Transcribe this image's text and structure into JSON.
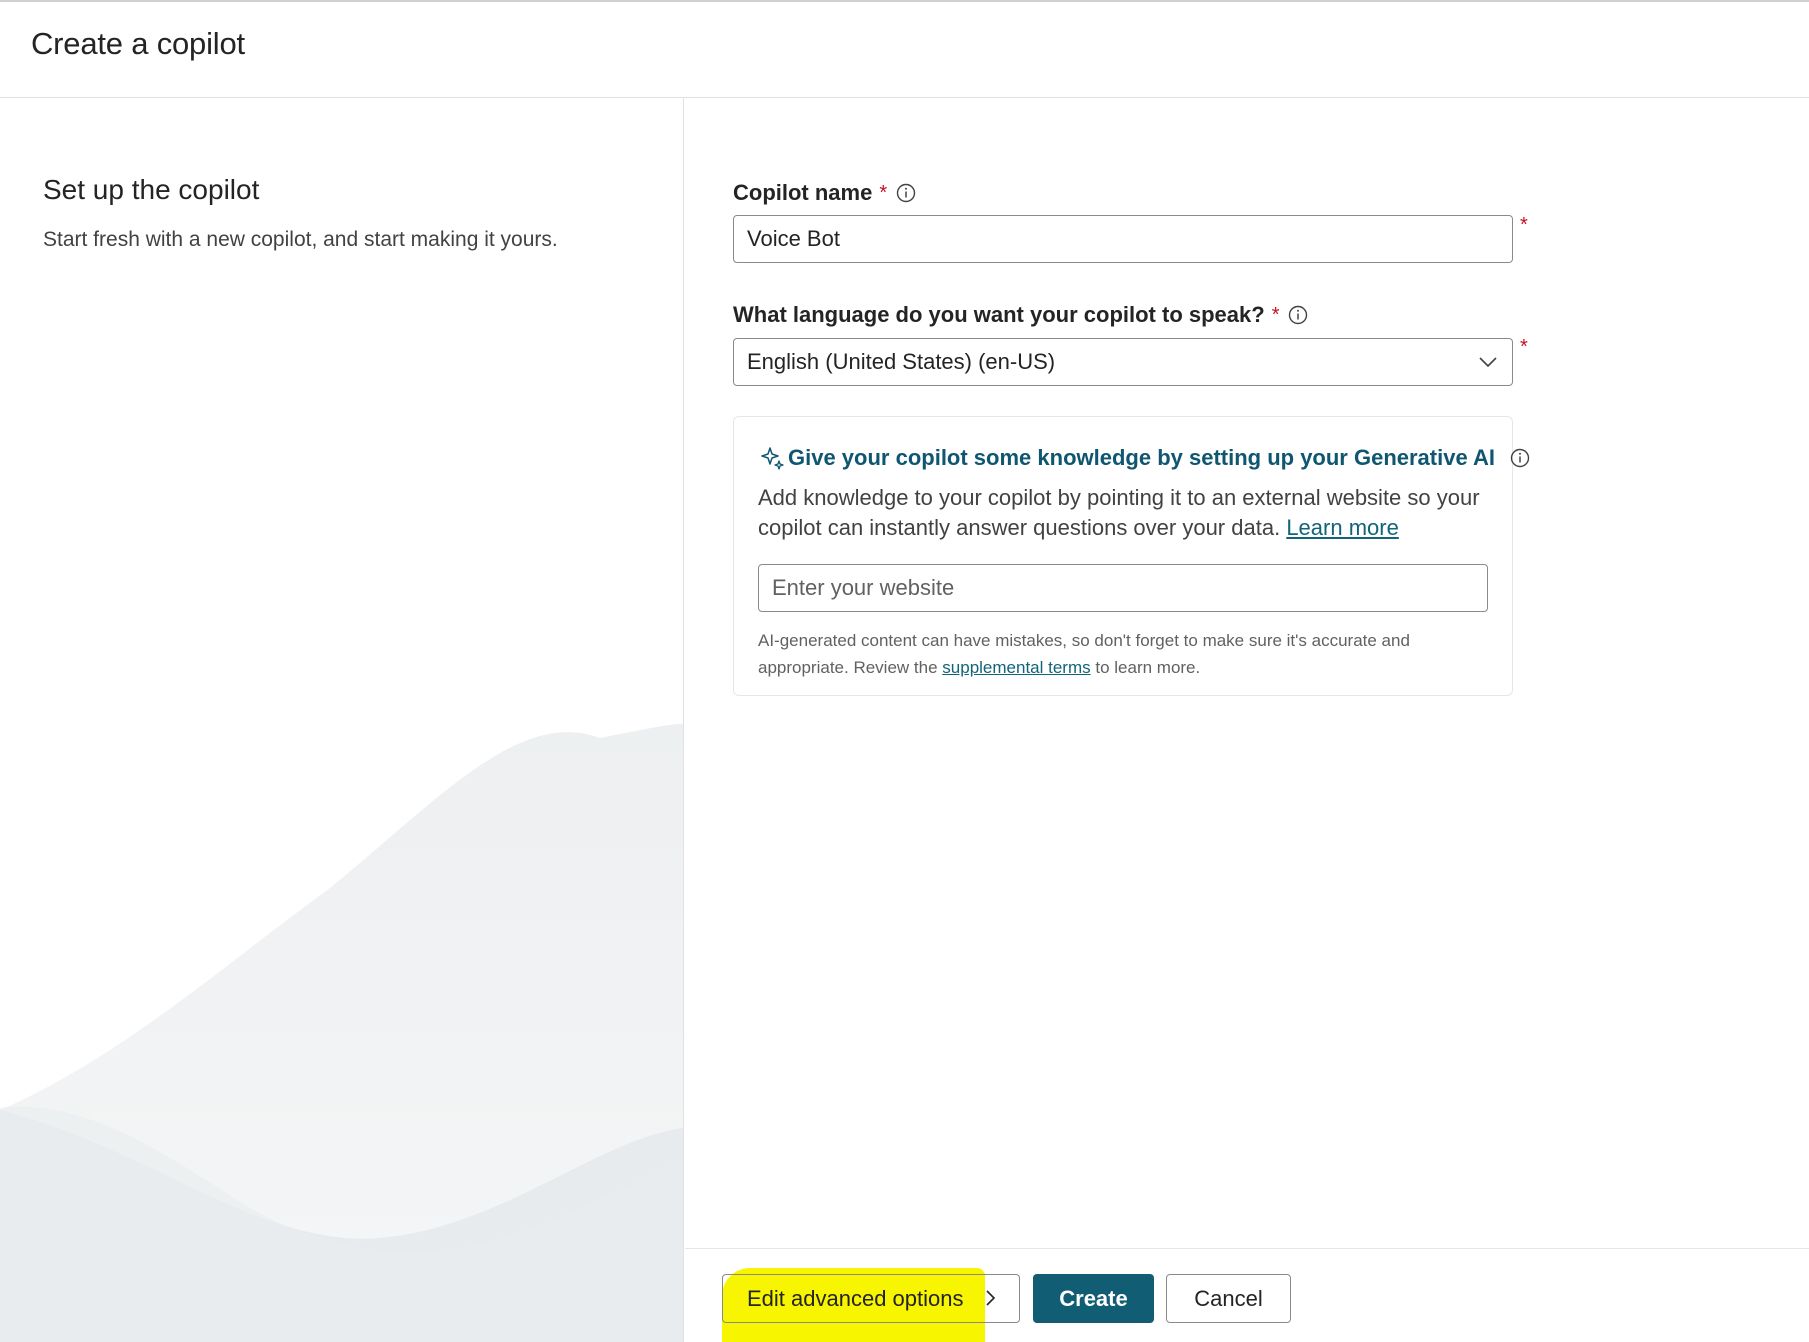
{
  "header": {
    "title": "Create a copilot"
  },
  "intro": {
    "title": "Set up the copilot",
    "subtitle": "Start fresh with a new copilot, and start making it yours."
  },
  "form": {
    "name_label": "Copilot name",
    "name_value": "Voice Bot",
    "language_label": "What language do you want your copilot to speak?",
    "language_value": "English (United States) (en-US)",
    "required_marker": "*"
  },
  "generative": {
    "title": "Give your copilot some knowledge by setting up your Generative AI",
    "description": "Add knowledge to your copilot by pointing it to an external website so your copilot can instantly answer questions over your data.",
    "learn_more": "Learn more",
    "website_placeholder": "Enter your website",
    "disclaimer_before": "AI-generated content can have mistakes, so don't forget to make sure it's accurate and appropriate. Review the",
    "disclaimer_link": "supplemental terms",
    "disclaimer_after": "to learn more."
  },
  "footer": {
    "advanced_label": "Edit advanced options",
    "create_label": "Create",
    "cancel_label": "Cancel"
  },
  "colors": {
    "accent": "#115e74",
    "required": "#c50f1f",
    "highlight": "#f7f500",
    "link": "#116479"
  },
  "icons": {
    "info": "info-icon",
    "sparkle": "sparkle-icon",
    "dropdown": "chevron-down-icon",
    "advanced": "chevron-right-icon"
  }
}
